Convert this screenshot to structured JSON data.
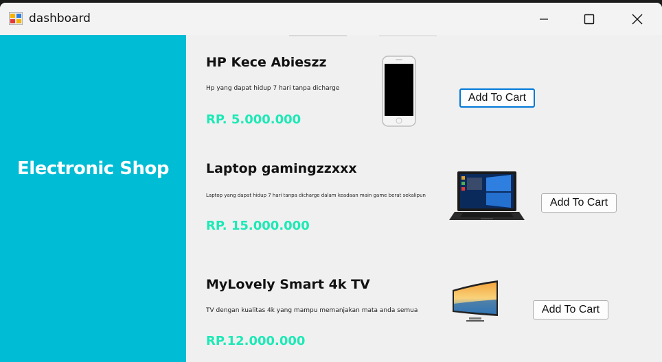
{
  "window": {
    "title": "dashboard",
    "icons": {
      "app": "app-icon",
      "minimize": "minimize-icon",
      "maximize": "maximize-icon",
      "close": "close-icon"
    }
  },
  "sidebar": {
    "brand": "Electronic Shop",
    "color": "#00bcd4"
  },
  "colors": {
    "price": "#1de9b6",
    "sidebar": "#00bcd4",
    "focus": "#0078d7"
  },
  "products": [
    {
      "name": "HP Kece Abieszz",
      "description": "Hp yang dapat hidup 7 hari tanpa dicharge",
      "price": "RP. 5.000.000",
      "button": "Add To Cart",
      "image": "smartphone-image"
    },
    {
      "name": "Laptop gamingzzxxx",
      "description": "Laptop yang dapat hidup 7 hari tanpa dicharge dalam keadaan main game berat sekalipun",
      "price": "RP. 15.000.000",
      "button": "Add To Cart",
      "image": "laptop-image"
    },
    {
      "name": "MyLovely Smart 4k TV",
      "description": "TV dengan kualitas 4k yang mampu memanjakan mata anda semua",
      "price": "RP.12.000.000",
      "button": "Add To Cart",
      "image": "tv-image"
    }
  ]
}
